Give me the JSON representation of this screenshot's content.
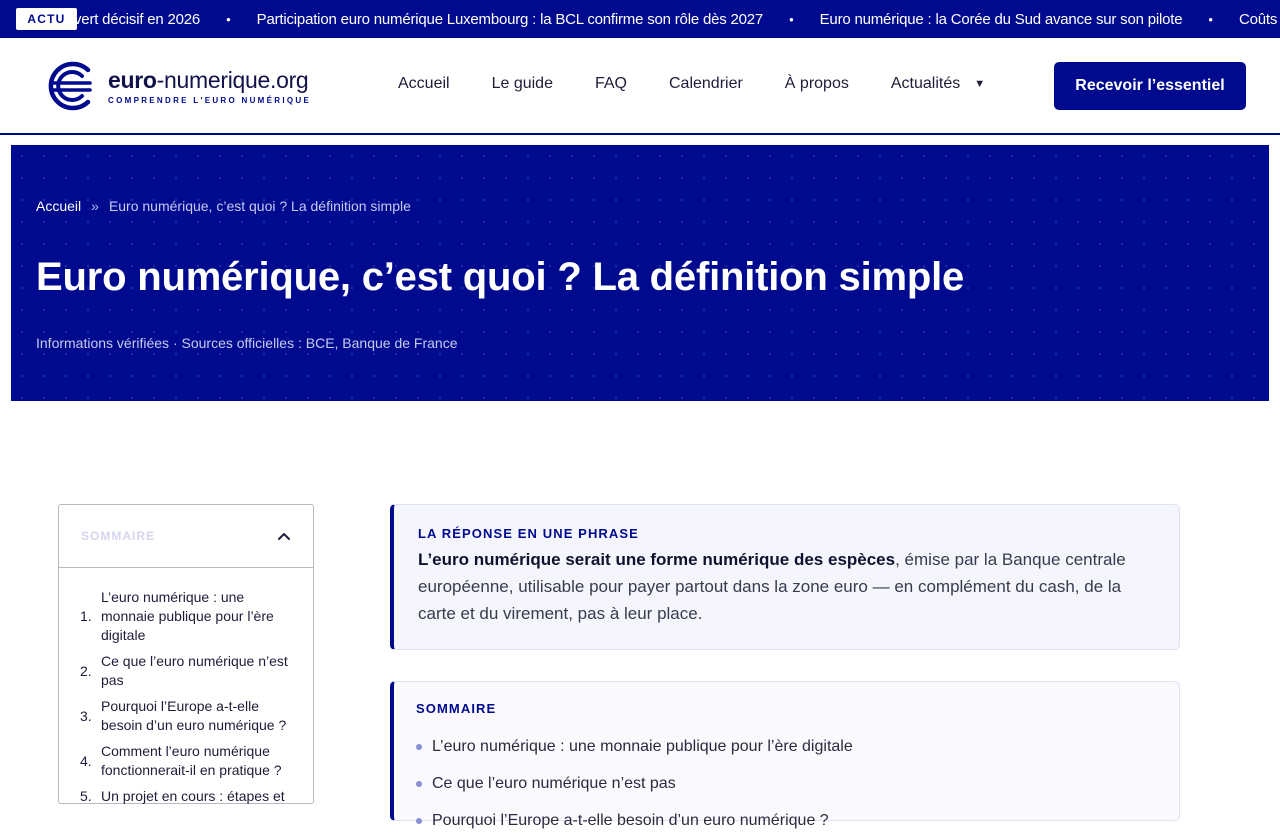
{
  "ticker": {
    "badge": "ACTU",
    "items": [
      "vert décisif en 2026",
      "Participation euro numérique Luxembourg : la BCL confirme son rôle dès 2027",
      "Euro numérique : la Corée du Sud avance sur son pilote",
      "Coûts eu"
    ],
    "separator": "•"
  },
  "header": {
    "logo_title_bold": "euro",
    "logo_title_rest": "-numerique.org",
    "logo_subtitle": "COMPRENDRE L'EURO NUMÉRIQUE",
    "nav": [
      "Accueil",
      "Le guide",
      "FAQ",
      "Calendrier",
      "À propos",
      "Actualités"
    ],
    "cta": "Recevoir l’essentiel"
  },
  "hero": {
    "breadcrumb_home": "Accueil",
    "breadcrumb_sep": "»",
    "breadcrumb_current": "Euro numérique, c’est quoi ? La définition simple",
    "title": "Euro numérique, c’est quoi ? La définition simple",
    "meta": "Informations vérifiées · Sources officielles : BCE, Banque de France"
  },
  "toc": {
    "title": "SOMMAIRE",
    "items": [
      {
        "num": "1.",
        "text": "L’euro numérique : une monnaie publique pour l’ère digitale"
      },
      {
        "num": "2.",
        "text": "Ce que l’euro numérique n’est pas"
      },
      {
        "num": "3.",
        "text": "Pourquoi l’Europe a-t-elle besoin d’un euro numérique ?"
      },
      {
        "num": "4.",
        "text": "Comment l’euro numérique fonctionnerait-il en pratique ?"
      },
      {
        "num": "5.",
        "text": "Un projet en cours : étapes et"
      }
    ]
  },
  "answer": {
    "label": "LA RÉPONSE EN UNE PHRASE",
    "bold": "L’euro numérique serait une forme numérique des espèces",
    "rest": ", émise par la Banque centrale européenne, utilisable pour payer partout dans la zone euro — en complément du cash, de la carte et du virement, pas à leur place."
  },
  "summary": {
    "label": "SOMMAIRE",
    "items": [
      "L’euro numérique : une monnaie publique pour l’ère digitale",
      "Ce que l’euro numérique n’est pas",
      "Pourquoi l’Europe a-t-elle besoin d’un euro numérique ?"
    ]
  },
  "colors": {
    "brand": "#000a8f",
    "white": "#ffffff",
    "accent_dot": "#8a8fd4"
  }
}
